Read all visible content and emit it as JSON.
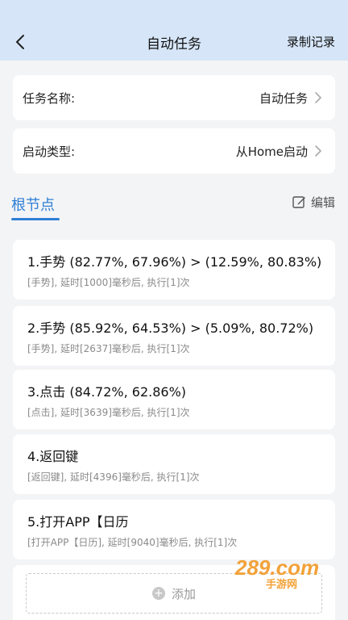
{
  "header": {
    "title": "自动任务",
    "record_label": "录制记录"
  },
  "task_name": {
    "label": "任务名称:",
    "value": "自动任务"
  },
  "start_type": {
    "label": "启动类型:",
    "value": "从Home启动"
  },
  "section": {
    "title": "根节点",
    "edit_label": "编辑"
  },
  "steps": [
    {
      "name": "1.手势 (82.77%, 67.96%) > (12.59%, 80.83%)",
      "desc": "[手势], 延时[1000]毫秒后, 执行[1]次"
    },
    {
      "name": "2.手势 (85.92%, 64.53%) > (5.09%, 80.72%)",
      "desc": "[手势], 延时[2637]毫秒后, 执行[1]次"
    },
    {
      "name": "3.点击 (84.72%, 62.86%)",
      "desc": "[点击], 延时[3639]毫秒后, 执行[1]次"
    },
    {
      "name": "4.返回键",
      "desc": "[返回键], 延时[4396]毫秒后, 执行[1]次"
    },
    {
      "name": "5.打开APP【日历",
      "desc": "[打开APP【日历], 延时[9040]毫秒后, 执行[1]次"
    }
  ],
  "add_label": "添加",
  "watermark": {
    "text": "289.com",
    "sub": "手游网"
  },
  "colors": {
    "header_bg": "#d6e6f8",
    "accent": "#2f7fd6",
    "edit_icon": "#555555"
  }
}
